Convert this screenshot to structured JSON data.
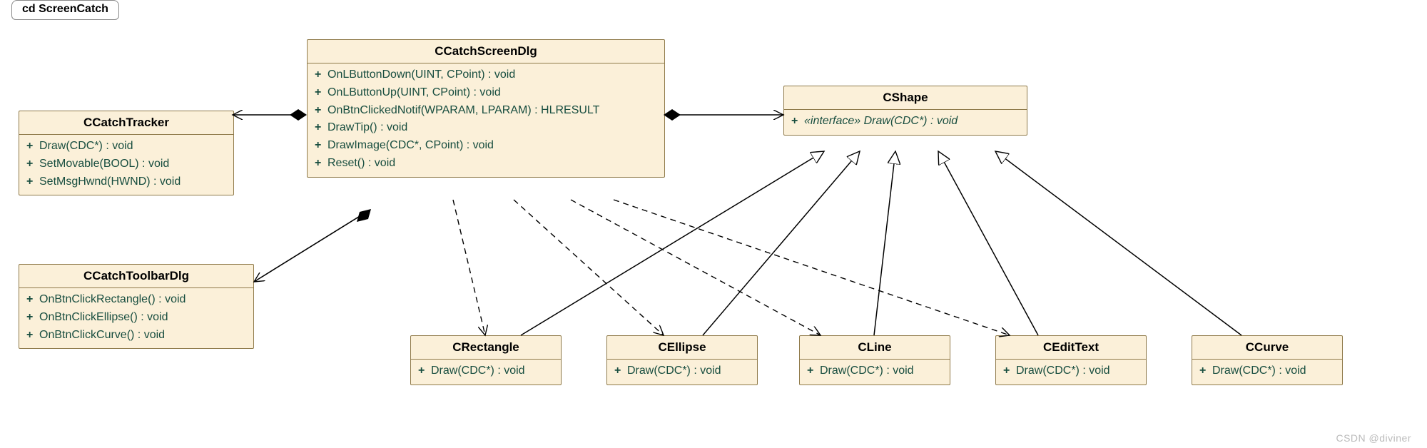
{
  "diagram_title": "cd ScreenCatch",
  "classes": {
    "ccatchtracker": {
      "name": "CCatchTracker",
      "ops": [
        "Draw(CDC*) : void",
        "SetMovable(BOOL) : void",
        "SetMsgHwnd(HWND) : void"
      ]
    },
    "ccatchtoolbardlg": {
      "name": "CCatchToolbarDlg",
      "ops": [
        "OnBtnClickRectangle() : void",
        "OnBtnClickEllipse() : void",
        "OnBtnClickCurve() : void"
      ]
    },
    "ccatchscreendlg": {
      "name": "CCatchScreenDlg",
      "ops": [
        "OnLButtonDown(UINT, CPoint) : void",
        "OnLButtonUp(UINT, CPoint) : void",
        "OnBtnClickedNotif(WPARAM, LPARAM) : HLRESULT",
        "DrawTip() : void",
        "DrawImage(CDC*, CPoint) : void",
        "Reset() : void"
      ]
    },
    "cshape": {
      "name": "CShape",
      "iface_op_prefix": "«interface» ",
      "iface_op": "Draw(CDC*) : void"
    },
    "crectangle": {
      "name": "CRectangle",
      "ops": [
        "Draw(CDC*) : void"
      ]
    },
    "cellipse": {
      "name": "CEllipse",
      "ops": [
        "Draw(CDC*) : void"
      ]
    },
    "cline": {
      "name": "CLine",
      "ops": [
        "Draw(CDC*) : void"
      ]
    },
    "cedittext": {
      "name": "CEditText",
      "ops": [
        "Draw(CDC*) : void"
      ]
    },
    "ccurve": {
      "name": "CCurve",
      "ops": [
        "Draw(CDC*) : void"
      ]
    }
  },
  "watermark": "CSDN @diviner"
}
